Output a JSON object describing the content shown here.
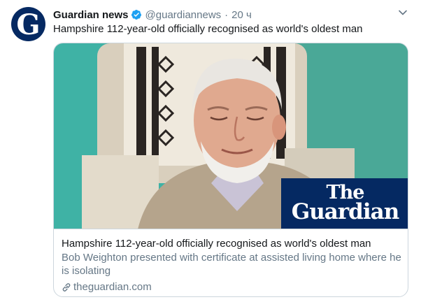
{
  "tweet": {
    "author": {
      "display_name": "Guardian news",
      "handle": "@guardiannews",
      "avatar_letter": "G",
      "verified": true
    },
    "separator": "·",
    "timestamp": "20 ч",
    "text": "Hampshire 112-year-old officially recognised as world's oldest man",
    "menu_icon": "chevron-down-icon"
  },
  "card": {
    "image_logo": {
      "line1": "The",
      "line2": "Guardian"
    },
    "title": "Hampshire 112-year-old officially recognised as world's oldest man",
    "description": "Bob Weighton presented with certificate at assisted living home where he is isolating",
    "link_icon": "link-icon",
    "domain": "theguardian.com"
  },
  "colors": {
    "guardian_blue": "#052962",
    "verified_blue": "#1da1f2",
    "secondary_text": "#657786",
    "border": "#ccd6dd"
  }
}
